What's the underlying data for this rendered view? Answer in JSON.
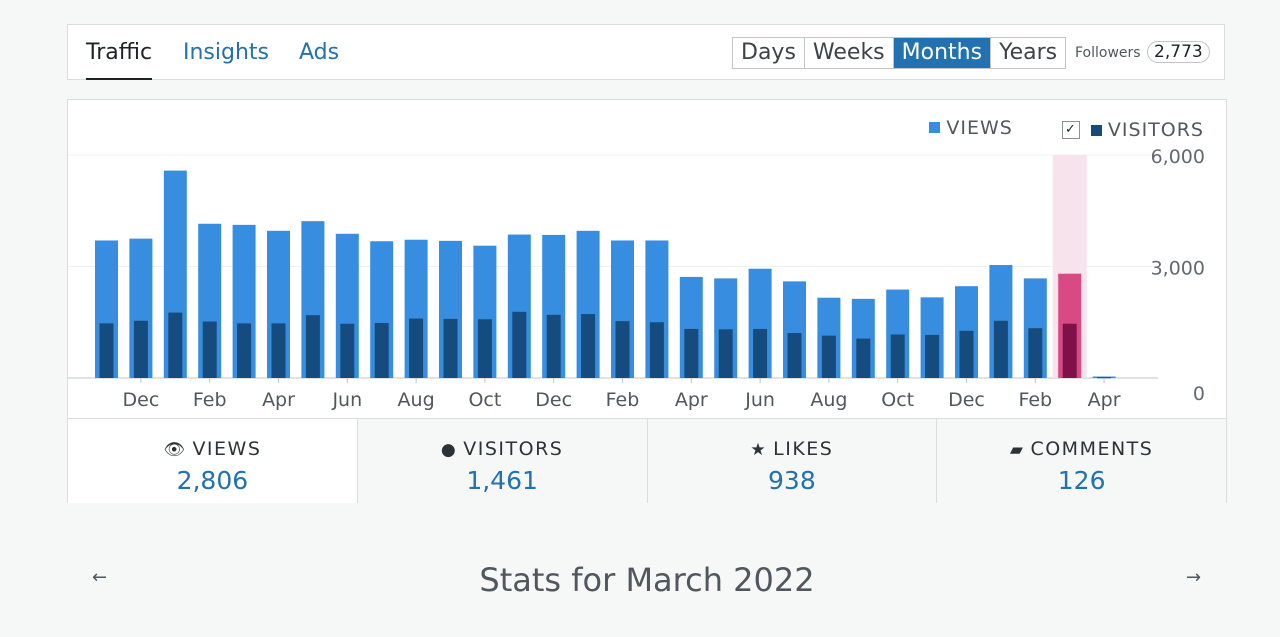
{
  "tabs": [
    {
      "label": "Traffic",
      "active": true
    },
    {
      "label": "Insights",
      "active": false
    },
    {
      "label": "Ads",
      "active": false
    }
  ],
  "period_buttons": [
    "Days",
    "Weeks",
    "Months",
    "Years"
  ],
  "selected_period": "Months",
  "followers": {
    "label": "Followers",
    "count": "2,773"
  },
  "legend": {
    "views": "VIEWS",
    "visitors": "VISITORS",
    "visitors_checked": true
  },
  "colors": {
    "views": "#378ee0",
    "visitors": "#164b7e",
    "highlight_views": "#d94a85",
    "highlight_visitors": "#7e1148",
    "highlight_band": "#f7e3ec"
  },
  "chart_data": {
    "type": "bar",
    "y_ticks": [
      "6,000",
      "3,000",
      "0"
    ],
    "ylim": [
      0,
      6000
    ],
    "x_labels": [
      "Dec",
      "Feb",
      "Apr",
      "Jun",
      "Aug",
      "Oct",
      "Dec",
      "Feb",
      "Apr",
      "Jun",
      "Aug",
      "Oct",
      "Dec",
      "Feb",
      "Apr"
    ],
    "views": [
      3700,
      3750,
      5580,
      4150,
      4120,
      3960,
      4220,
      3880,
      3680,
      3720,
      3690,
      3560,
      3860,
      3850,
      3960,
      3700,
      3700,
      2720,
      2680,
      2940,
      2600,
      2160,
      2130,
      2380,
      2170,
      2470,
      3040,
      2680,
      2806,
      40
    ],
    "visitors": [
      1470,
      1540,
      1760,
      1520,
      1470,
      1470,
      1690,
      1460,
      1480,
      1600,
      1590,
      1580,
      1780,
      1700,
      1720,
      1530,
      1500,
      1320,
      1310,
      1320,
      1210,
      1140,
      1060,
      1170,
      1160,
      1270,
      1540,
      1340,
      1461,
      20
    ],
    "highlight_index": 28,
    "grid": true
  },
  "stats": [
    {
      "icon": "eye-icon",
      "label": "VIEWS",
      "value": "2,806",
      "active": true
    },
    {
      "icon": "person-icon",
      "label": "VISITORS",
      "value": "1,461",
      "active": false
    },
    {
      "icon": "star-icon",
      "label": "LIKES",
      "value": "938",
      "active": false
    },
    {
      "icon": "comment-icon",
      "label": "COMMENTS",
      "value": "126",
      "active": false
    }
  ],
  "nav": {
    "title": "Stats for March 2022"
  }
}
